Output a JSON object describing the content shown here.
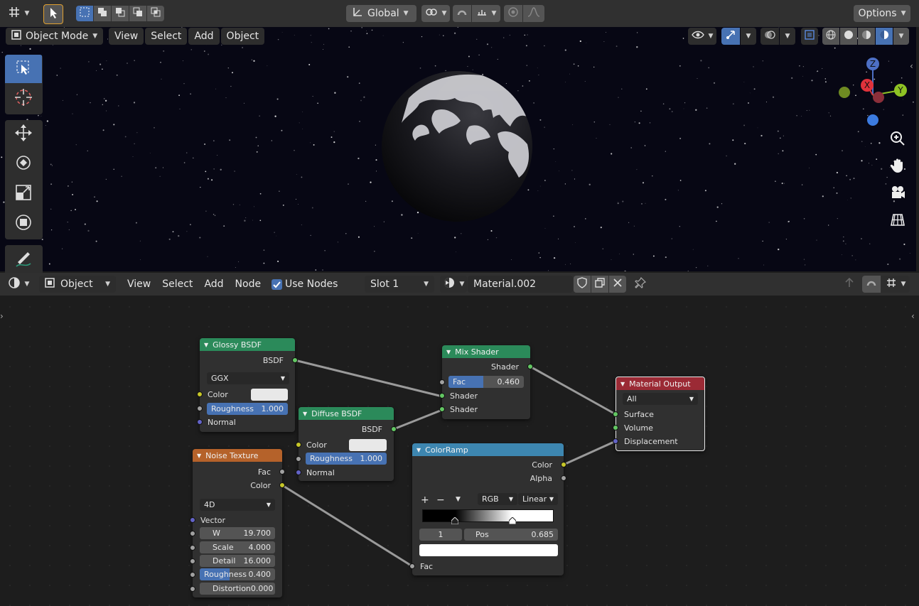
{
  "topbar": {
    "transform_orientation": "Global",
    "options_label": "Options"
  },
  "viewport_header": {
    "mode": "Object Mode",
    "menus": [
      "View",
      "Select",
      "Add",
      "Object"
    ]
  },
  "gizmo": {
    "x": "X",
    "y": "Y",
    "z": "Z"
  },
  "node_header": {
    "editor_type": "Object",
    "menus": [
      "View",
      "Select",
      "Add",
      "Node"
    ],
    "use_nodes_label": "Use Nodes",
    "use_nodes_checked": true,
    "slot": "Slot 1",
    "material": "Material.002"
  },
  "nodes": {
    "glossy": {
      "title": "Glossy BSDF",
      "out_bsdf": "BSDF",
      "distribution": "GGX",
      "color_label": "Color",
      "roughness_label": "Roughness",
      "roughness_value": "1.000",
      "normal_label": "Normal",
      "color": "#e8e8e8",
      "header_color": "#2b8a5a"
    },
    "diffuse": {
      "title": "Diffuse BSDF",
      "out_bsdf": "BSDF",
      "color_label": "Color",
      "roughness_label": "Roughness",
      "roughness_value": "1.000",
      "normal_label": "Normal",
      "header_color": "#2b8a5a"
    },
    "mix": {
      "title": "Mix Shader",
      "out_shader": "Shader",
      "fac_label": "Fac",
      "fac_value": "0.460",
      "in_shader_1": "Shader",
      "in_shader_2": "Shader",
      "fac_fraction": 0.46,
      "header_color": "#2b8a5a"
    },
    "output": {
      "title": "Material Output",
      "target": "All",
      "surface": "Surface",
      "volume": "Volume",
      "displacement": "Displacement",
      "header_color": "#9b2a35"
    },
    "noise": {
      "title": "Noise Texture",
      "out_fac": "Fac",
      "out_color": "Color",
      "dimensions": "4D",
      "vector_label": "Vector",
      "fields": [
        {
          "label": "W",
          "value": "19.700"
        },
        {
          "label": "Scale",
          "value": "4.000"
        },
        {
          "label": "Detail",
          "value": "16.000"
        },
        {
          "label": "Roughness",
          "value": "0.400"
        },
        {
          "label": "Distortion",
          "value": "0.000"
        }
      ],
      "roughness_fraction": 0.4,
      "header_color": "#b5622a"
    },
    "colorramp": {
      "title": "ColorRamp",
      "out_color": "Color",
      "out_alpha": "Alpha",
      "add": "+",
      "remove": "−",
      "color_mode": "RGB",
      "interpolation": "Linear",
      "active_index": "1",
      "pos_label": "Pos",
      "pos_value": "0.685",
      "stop_positions": [
        0.25,
        0.685
      ],
      "fac_label": "Fac",
      "header_color": "#3d86b0"
    }
  },
  "colors": {
    "header_bg": "#303030",
    "accent_blue": "#4772b3",
    "viewport_bg": "#070714"
  }
}
